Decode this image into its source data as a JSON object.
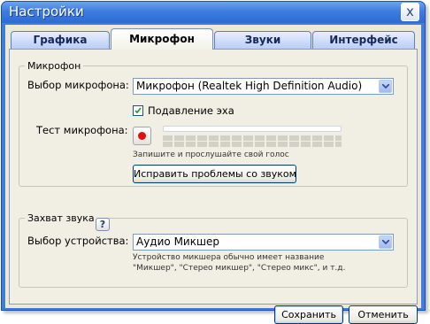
{
  "window": {
    "title": "Настройки",
    "close_label": "x"
  },
  "tabs": [
    {
      "label": "Графика",
      "active": false
    },
    {
      "label": "Микрофон",
      "active": true
    },
    {
      "label": "Звуки",
      "active": false
    },
    {
      "label": "Интерфейс",
      "active": false
    }
  ],
  "microphone_group": {
    "legend": "Микрофон",
    "select_label": "Выбор микрофона:",
    "select_value": "Микрофон (Realtek High Definition Audio)",
    "echo_checkbox_label": "Подавление эха",
    "echo_checked": true,
    "test_label": "Тест микрофона:",
    "test_hint": "Запишите и прослушайте свой голос",
    "record_progress": 0.0,
    "fix_button": "Исправить проблемы со звуком"
  },
  "capture_group": {
    "legend": "Захват звука",
    "help_label": "?",
    "device_label": "Выбор устройства:",
    "device_value": "Аудио Микшер",
    "device_hint_line1": "Устройство микшера обычно имеет название",
    "device_hint_line2": "\"Микшер\", \"Стерео микшер\", \"Стерео микс\", и т.д."
  },
  "footer": {
    "save_button": "Сохранить",
    "cancel_button": "Отменить"
  },
  "colors": {
    "titlebar": "#3d7de0",
    "record": "#e01010",
    "dialog_bg": "#ece9d8"
  }
}
